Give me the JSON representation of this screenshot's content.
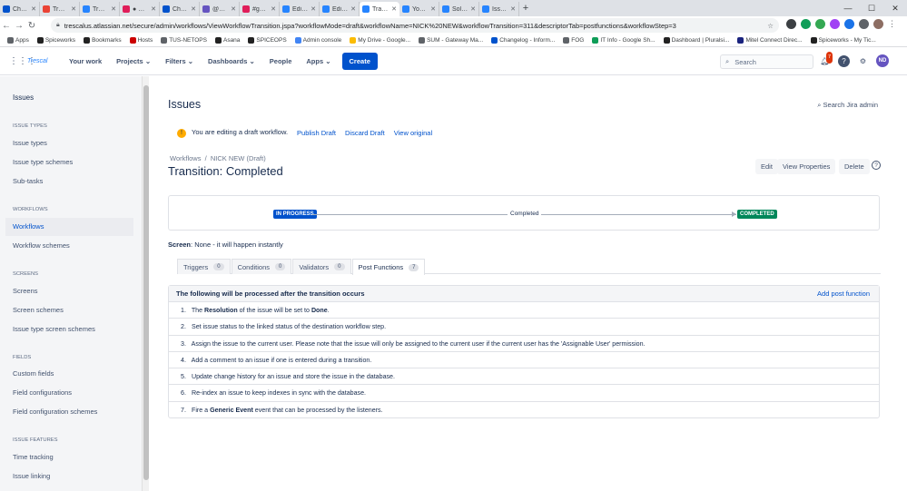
{
  "browser": {
    "tabs": [
      {
        "label": "Changelog",
        "color": "#0052cc"
      },
      {
        "label": "Trescal IT / I",
        "color": "#ea4335"
      },
      {
        "label": "Trescal, Inc",
        "color": "#2684ff"
      },
      {
        "label": "● Matthew",
        "color": "#e01e5a"
      },
      {
        "label": "Changelog",
        "color": "#0052cc"
      },
      {
        "label": "@Frostythe",
        "color": "#6554c0"
      },
      {
        "label": "#general",
        "color": "#e01e5a"
      },
      {
        "label": "Edit — NICK",
        "color": "#2684ff"
      },
      {
        "label": "Edit — NICK",
        "color": "#2684ff"
      },
      {
        "label": "Transition: C",
        "color": "#2684ff"
      },
      {
        "label": "Your work",
        "color": "#2684ff"
      },
      {
        "label": "Solved: How",
        "color": "#2684ff"
      },
      {
        "label": "Issues autom",
        "color": "#2684ff"
      }
    ],
    "url": "trescalus.atlassian.net/secure/admin/workflows/ViewWorkflowTransition.jspa?workflowMode=draft&workflowName=NICK%20NEW&workflowTransition=311&descriptorTab=postfunctions&workflowStep=3",
    "bookmarks": [
      {
        "label": "Apps",
        "color": "#5f6368"
      },
      {
        "label": "Spiceworks",
        "color": "#222"
      },
      {
        "label": "Bookmarks",
        "color": "#222"
      },
      {
        "label": "Hosts",
        "color": "#c00"
      },
      {
        "label": "TUS-NETOPS",
        "color": "#5f6368"
      },
      {
        "label": "Asana",
        "color": "#222"
      },
      {
        "label": "SPICEOPS",
        "color": "#222"
      },
      {
        "label": "Admin console",
        "color": "#4285f4"
      },
      {
        "label": "My Drive - Google...",
        "color": "#fbbc04"
      },
      {
        "label": "SUM - Gateway Ma...",
        "color": "#5f6368"
      },
      {
        "label": "Changelog - Inform...",
        "color": "#0052cc"
      },
      {
        "label": "FOG",
        "color": "#5f6368"
      },
      {
        "label": "IT Info - Google Sh...",
        "color": "#0f9d58"
      },
      {
        "label": "Dashboard | Pluralsi...",
        "color": "#222"
      },
      {
        "label": "Mitel Connect Direc...",
        "color": "#1a237e"
      },
      {
        "label": "Spiceworks - My Tic...",
        "color": "#222"
      }
    ]
  },
  "jira_nav": {
    "logo": "Trescal",
    "items": [
      "Your work",
      "Projects",
      "Filters",
      "Dashboards",
      "People",
      "Apps"
    ],
    "create": "Create",
    "search_placeholder": "Search",
    "notif_count": "7",
    "avatar": "ND"
  },
  "sidebar": {
    "title": "Issues",
    "sections": [
      {
        "heading": "ISSUE TYPES",
        "items": [
          "Issue types",
          "Issue type schemes",
          "Sub-tasks"
        ]
      },
      {
        "heading": "WORKFLOWS",
        "items": [
          "Workflows",
          "Workflow schemes"
        ]
      },
      {
        "heading": "SCREENS",
        "items": [
          "Screens",
          "Screen schemes",
          "Issue type screen schemes"
        ]
      },
      {
        "heading": "FIELDS",
        "items": [
          "Custom fields",
          "Field configurations",
          "Field configuration schemes"
        ]
      },
      {
        "heading": "ISSUE FEATURES",
        "items": [
          "Time tracking",
          "Issue linking"
        ]
      }
    ]
  },
  "main": {
    "page_title": "Issues",
    "search_admin": "Search Jira admin",
    "draft_msg": "You are editing a draft workflow.",
    "publish": "Publish Draft",
    "discard": "Discard Draft",
    "view_original": "View original",
    "crumb_workflows": "Workflows",
    "crumb_sep": "/",
    "crumb_current": "NICK NEW (Draft)",
    "transition_title": "Transition: Completed",
    "edit": "Edit",
    "view_props": "View Properties",
    "delete": "Delete",
    "diagram": {
      "from": "IN PROGRESS",
      "label": "Completed",
      "to": "COMPLETED",
      "from_color": "#0052cc",
      "to_color": "#00875a"
    },
    "screen_label": "Screen",
    "screen_value": ": None - it will happen instantly",
    "tabs": [
      {
        "label": "Triggers",
        "count": "0"
      },
      {
        "label": "Conditions",
        "count": "0"
      },
      {
        "label": "Validators",
        "count": "0"
      },
      {
        "label": "Post Functions",
        "count": "7"
      }
    ],
    "pf_header": "The following will be processed after the transition occurs",
    "add_pf": "Add post function",
    "pf": [
      {
        "n": "1.",
        "pre": "The ",
        "b1": "Resolution",
        "mid": " of the issue will be set to ",
        "b2": "Done",
        "post": "."
      },
      {
        "n": "2.",
        "pre": "Set issue status to the linked status of the destination workflow step.",
        "b1": "",
        "mid": "",
        "b2": "",
        "post": ""
      },
      {
        "n": "3.",
        "pre": "Assign the issue to the current user. Please note that the issue will only be assigned to the current user if the current user has the 'Assignable User' permission.",
        "b1": "",
        "mid": "",
        "b2": "",
        "post": ""
      },
      {
        "n": "4.",
        "pre": "Add a comment to an issue if one is entered during a transition.",
        "b1": "",
        "mid": "",
        "b2": "",
        "post": ""
      },
      {
        "n": "5.",
        "pre": "Update change history for an issue and store the issue in the database.",
        "b1": "",
        "mid": "",
        "b2": "",
        "post": ""
      },
      {
        "n": "6.",
        "pre": "Re-index an issue to keep indexes in sync with the database.",
        "b1": "",
        "mid": "",
        "b2": "",
        "post": ""
      },
      {
        "n": "7.",
        "pre": "Fire a ",
        "b1": "Generic Event",
        "mid": " event that can be processed by the listeners.",
        "b2": "",
        "post": ""
      }
    ]
  }
}
